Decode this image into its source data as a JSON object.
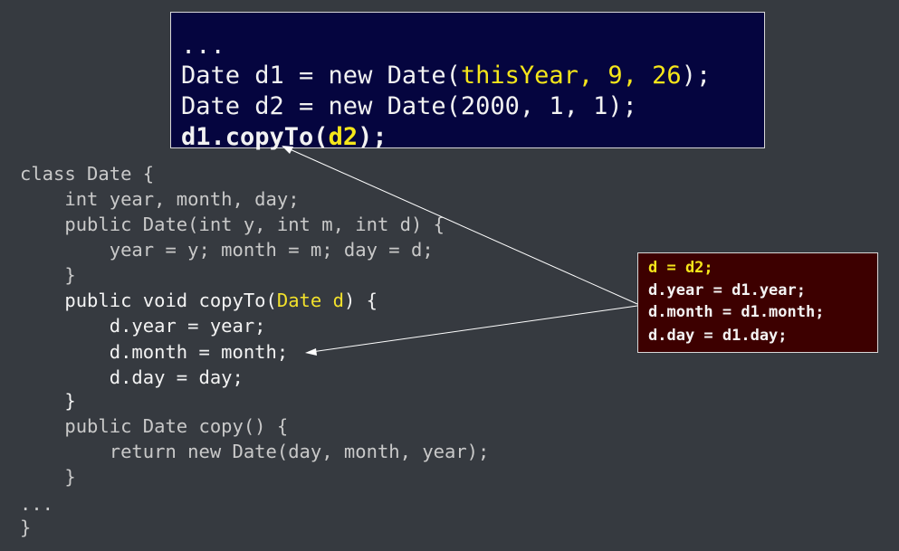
{
  "top_box": {
    "line1": "...",
    "line2_a": "Date d1 = new Date(",
    "line2_b": "thisYear, 9, 26",
    "line2_c": ");",
    "line3": "Date d2 = new Date(2000, 1, 1);",
    "line4_a": "d1.copyTo(",
    "line4_b": "d2",
    "line4_c": ");"
  },
  "class_code": {
    "l01": "class Date {",
    "l02": "    int year, month, day;",
    "l03": "    public Date(int y, int m, int d) {",
    "l04": "        year = y; month = m; day = d;",
    "l05": "    }",
    "l06_a": "    public void copyTo(",
    "l06_b": "Date d",
    "l06_c": ") {",
    "l07": "        d.year = year;",
    "l08": "        d.month = month;",
    "l09": "        d.day = day;",
    "l10": "    }",
    "l11": "    public Date copy() {",
    "l12": "        return new Date(day, month, year);",
    "l13": "    }",
    "l14": "...",
    "l15": "}"
  },
  "side_box": {
    "line1": "d = d2;",
    "line2": "d.year = d1.year;",
    "line3": "d.month = d1.month;",
    "line4": "d.day = d1.day;"
  },
  "colors": {
    "background": "#363a40",
    "top_box_bg": "#05053f",
    "side_box_bg": "#3d0000",
    "highlight": "#f5e61a"
  }
}
